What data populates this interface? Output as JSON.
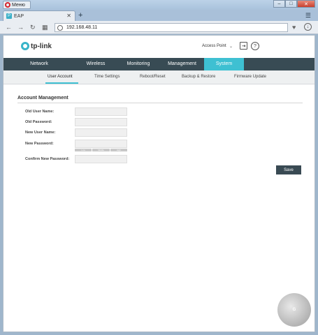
{
  "browser": {
    "menu_label": "Меню",
    "tab_title": "EAP",
    "tab_icon_letter": "P",
    "new_tab_symbol": "+",
    "url": "192.168.48.11",
    "minimize": "–",
    "maximize": "□",
    "close": "✕"
  },
  "header": {
    "logo_text": "tp-link",
    "mode": "Access Point",
    "mode_chevron": "⌄",
    "logout_icon": "⇥",
    "help_icon": "?"
  },
  "mainnav": {
    "items": [
      {
        "label": "Network"
      },
      {
        "label": "Wireless"
      },
      {
        "label": "Monitoring"
      },
      {
        "label": "Management"
      },
      {
        "label": "System"
      }
    ],
    "active": "System"
  },
  "subnav": {
    "items": [
      {
        "label": "User Account"
      },
      {
        "label": "Time Settings"
      },
      {
        "label": "Reboot/Reset"
      },
      {
        "label": "Backup & Restore"
      },
      {
        "label": "Firmware Update"
      }
    ],
    "active": "User Account"
  },
  "form": {
    "title": "Account Management",
    "fields": [
      {
        "label": "Old User Name:",
        "value": ""
      },
      {
        "label": "Old Password:",
        "value": ""
      },
      {
        "label": "New User Name:",
        "value": ""
      },
      {
        "label": "New Password:",
        "value": ""
      },
      {
        "label": "Confirm New Password:",
        "value": ""
      }
    ],
    "strength": [
      "Low",
      "Middle",
      "High"
    ],
    "save_label": "Save"
  },
  "colors": {
    "accent": "#3ec0d2",
    "nav_bg": "#384b54",
    "button_bg": "#394a53"
  }
}
